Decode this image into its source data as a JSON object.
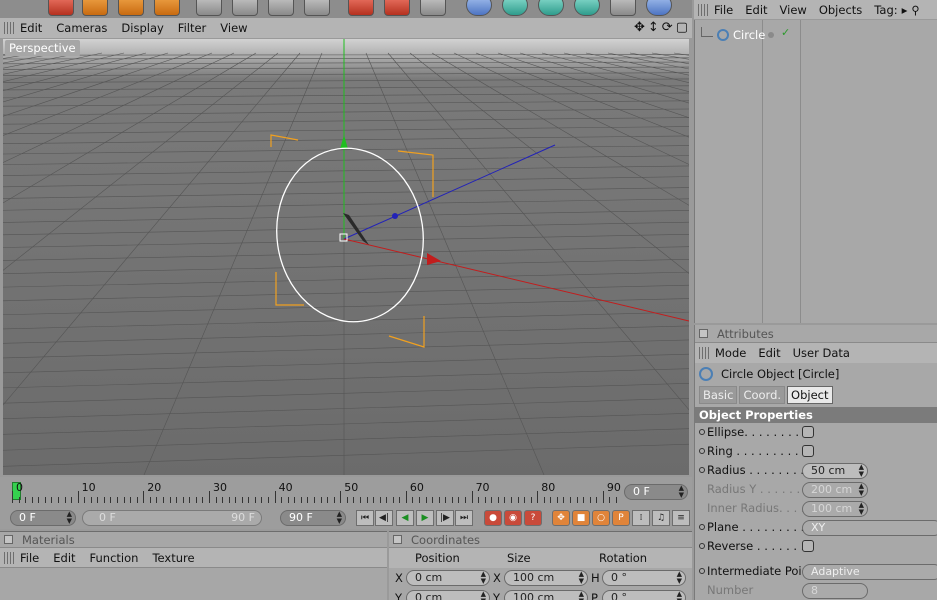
{
  "viewport": {
    "menu": [
      "Edit",
      "Cameras",
      "Display",
      "Filter",
      "View"
    ],
    "view_name": "Perspective",
    "nav_icons": [
      "move-icon",
      "zoom-icon",
      "rotate-icon",
      "maximize-icon"
    ]
  },
  "timeline": {
    "ticks": [
      "0",
      "10",
      "20",
      "30",
      "40",
      "50",
      "60",
      "70",
      "80",
      "90"
    ],
    "end_frame": "0 F",
    "current_frame": "0 F",
    "range_start": "0 F",
    "range_end": "90 F",
    "max_frame": "90 F"
  },
  "materials": {
    "title": "Materials",
    "menu": [
      "File",
      "Edit",
      "Function",
      "Texture"
    ]
  },
  "coordinates": {
    "title": "Coordinates",
    "headers": {
      "position": "Position",
      "size": "Size",
      "rotation": "Rotation"
    },
    "rows": [
      {
        "pos_axis": "X",
        "pos_value": "0 cm",
        "size_axis": "X",
        "size_value": "100 cm",
        "rot_axis": "H",
        "rot_value": "0 °"
      },
      {
        "pos_axis": "Y",
        "pos_value": "0 cm",
        "size_axis": "Y",
        "size_value": "100 cm",
        "rot_axis": "P",
        "rot_value": "0 °"
      }
    ]
  },
  "object_manager": {
    "menu": [
      "File",
      "Edit",
      "View",
      "Objects",
      "Tag:"
    ],
    "objects": [
      {
        "name": "Circle"
      }
    ]
  },
  "attributes": {
    "title": "Attributes",
    "menu": [
      "Mode",
      "Edit",
      "User Data"
    ],
    "object_title": "Circle Object [Circle]",
    "tabs": [
      "Basic",
      "Coord.",
      "Object"
    ],
    "active_tab": "Object",
    "section": "Object Properties",
    "props": {
      "ellipse": "Ellipse. . . . . . . . . .",
      "ring": "Ring . . . . . . . . . . .",
      "radius": "Radius . . . . . . . . .",
      "radius_value": "50 cm",
      "radius_y": "Radius Y . . . . . . .",
      "radius_y_value": "200 cm",
      "inner_radius": "Inner Radius. . . . .",
      "inner_radius_value": "100 cm",
      "plane": "Plane . . . . . . . . . .",
      "plane_value": "XY",
      "reverse": "Reverse . . . . . . . .",
      "intermediate": "Intermediate Points",
      "intermediate_value": "Adaptive",
      "number": "Number",
      "number_value": "8"
    }
  },
  "colors": {
    "x_axis": "#c21d1d",
    "y_axis": "#1fbf1f",
    "z_axis": "#2222b8",
    "selection": "#f0a020",
    "playhead": "#35d04f"
  }
}
